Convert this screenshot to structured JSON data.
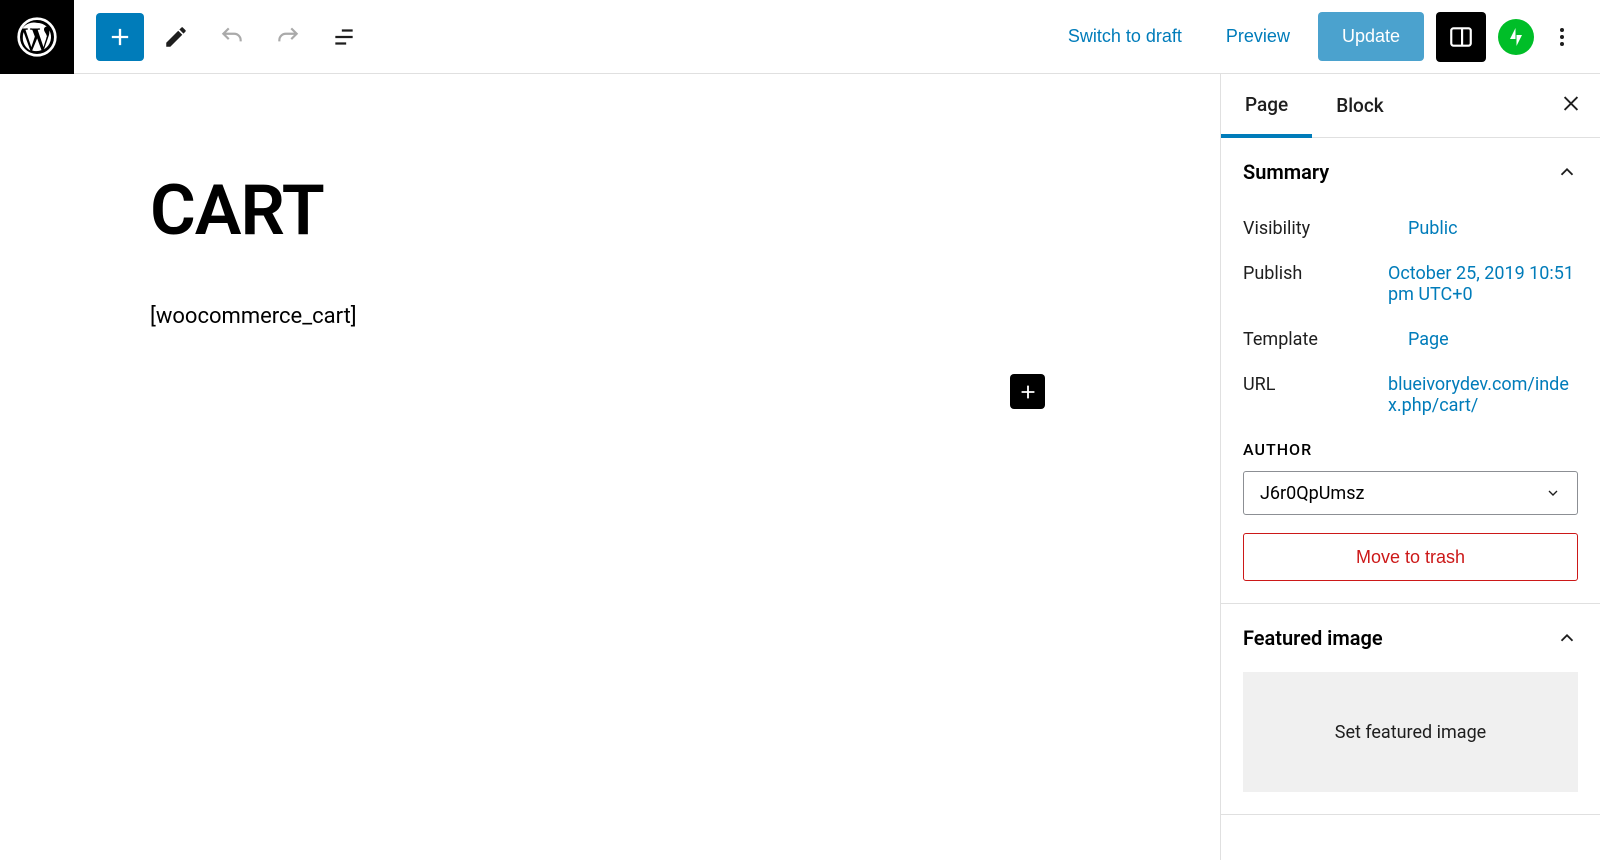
{
  "toolbar": {
    "switch_to_draft": "Switch to draft",
    "preview": "Preview",
    "update": "Update"
  },
  "editor": {
    "title": "CART",
    "content": "[woocommerce_cart]"
  },
  "sidebar": {
    "tabs": {
      "page": "Page",
      "block": "Block"
    },
    "summary": {
      "title": "Summary",
      "visibility_label": "Visibility",
      "visibility_value": "Public",
      "publish_label": "Publish",
      "publish_value": "October 25, 2019 10:51 pm UTC+0",
      "template_label": "Template",
      "template_value": "Page",
      "url_label": "URL",
      "url_value": "blueivorydev.com/index.php/cart/",
      "author_label": "AUTHOR",
      "author_value": "J6r0QpUmsz",
      "trash": "Move to trash"
    },
    "featured": {
      "title": "Featured image",
      "button": "Set featured image"
    }
  }
}
